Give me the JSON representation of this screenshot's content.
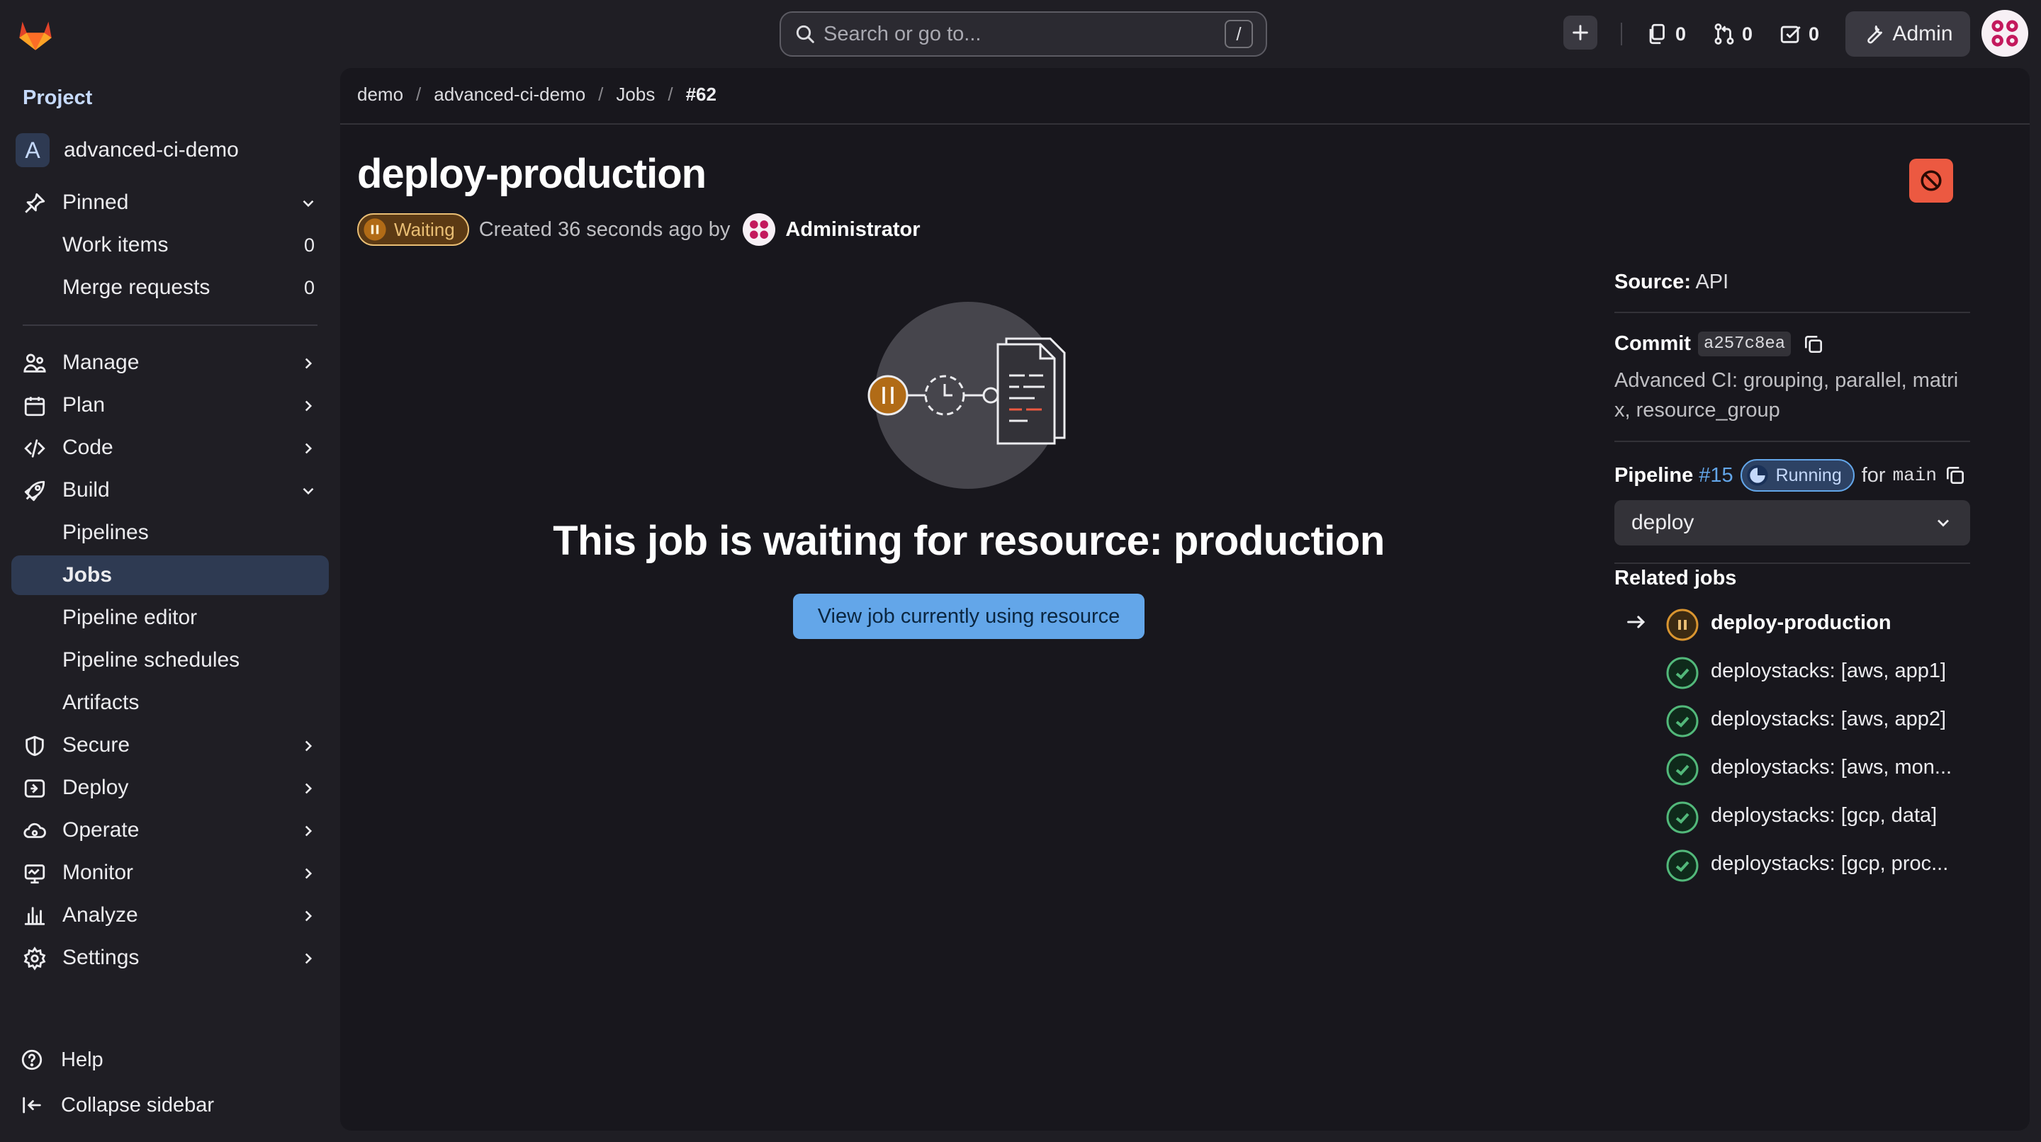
{
  "colors": {
    "accent_blue": "#63a6e9",
    "waiting_orange": "#e9be74",
    "success_green": "#52b87a",
    "danger_red": "#ec5941",
    "sidebar_active": "#2e3a52"
  },
  "topbar": {
    "search_placeholder": "Search or go to...",
    "search_shortcut": "/",
    "issues_count": "0",
    "merge_requests_count": "0",
    "todos_count": "0",
    "admin_label": "Admin"
  },
  "sidebar": {
    "heading": "Project",
    "project_initial": "A",
    "project_name": "advanced-ci-demo",
    "pinned": {
      "label": "Pinned",
      "items": [
        {
          "label": "Work items",
          "count": "0"
        },
        {
          "label": "Merge requests",
          "count": "0"
        }
      ]
    },
    "sections": {
      "manage": "Manage",
      "plan": "Plan",
      "code": "Code",
      "build": "Build",
      "secure": "Secure",
      "deploy": "Deploy",
      "operate": "Operate",
      "monitor": "Monitor",
      "analyze": "Analyze",
      "settings": "Settings"
    },
    "build_items": [
      "Pipelines",
      "Jobs",
      "Pipeline editor",
      "Pipeline schedules",
      "Artifacts"
    ],
    "help": "Help",
    "collapse": "Collapse sidebar"
  },
  "breadcrumbs": [
    "demo",
    "advanced-ci-demo",
    "Jobs",
    "#62"
  ],
  "job": {
    "title": "deploy-production",
    "status": "Waiting",
    "created_text": "Created 36 seconds ago by",
    "author": "Administrator"
  },
  "empty_state": {
    "title": "This job is waiting for resource: production",
    "button": "View job currently using resource"
  },
  "details": {
    "source_label": "Source:",
    "source_value": "API",
    "commit_label": "Commit",
    "commit_sha": "a257c8ea",
    "commit_message": "Advanced CI: grouping, parallel, matrix, resource_group",
    "pipeline_label": "Pipeline",
    "pipeline_id": "#15",
    "pipeline_status": "Running",
    "for_text": "for",
    "branch": "main",
    "stage": "deploy",
    "related_title": "Related jobs",
    "related_jobs": [
      {
        "name": "deploy-production",
        "status": "waiting",
        "current": true
      },
      {
        "name": "deploystacks: [aws, app1]",
        "status": "success"
      },
      {
        "name": "deploystacks: [aws, app2]",
        "status": "success"
      },
      {
        "name": "deploystacks: [aws, mon...",
        "status": "success"
      },
      {
        "name": "deploystacks: [gcp, data]",
        "status": "success"
      },
      {
        "name": "deploystacks: [gcp, proc...",
        "status": "success"
      }
    ]
  }
}
